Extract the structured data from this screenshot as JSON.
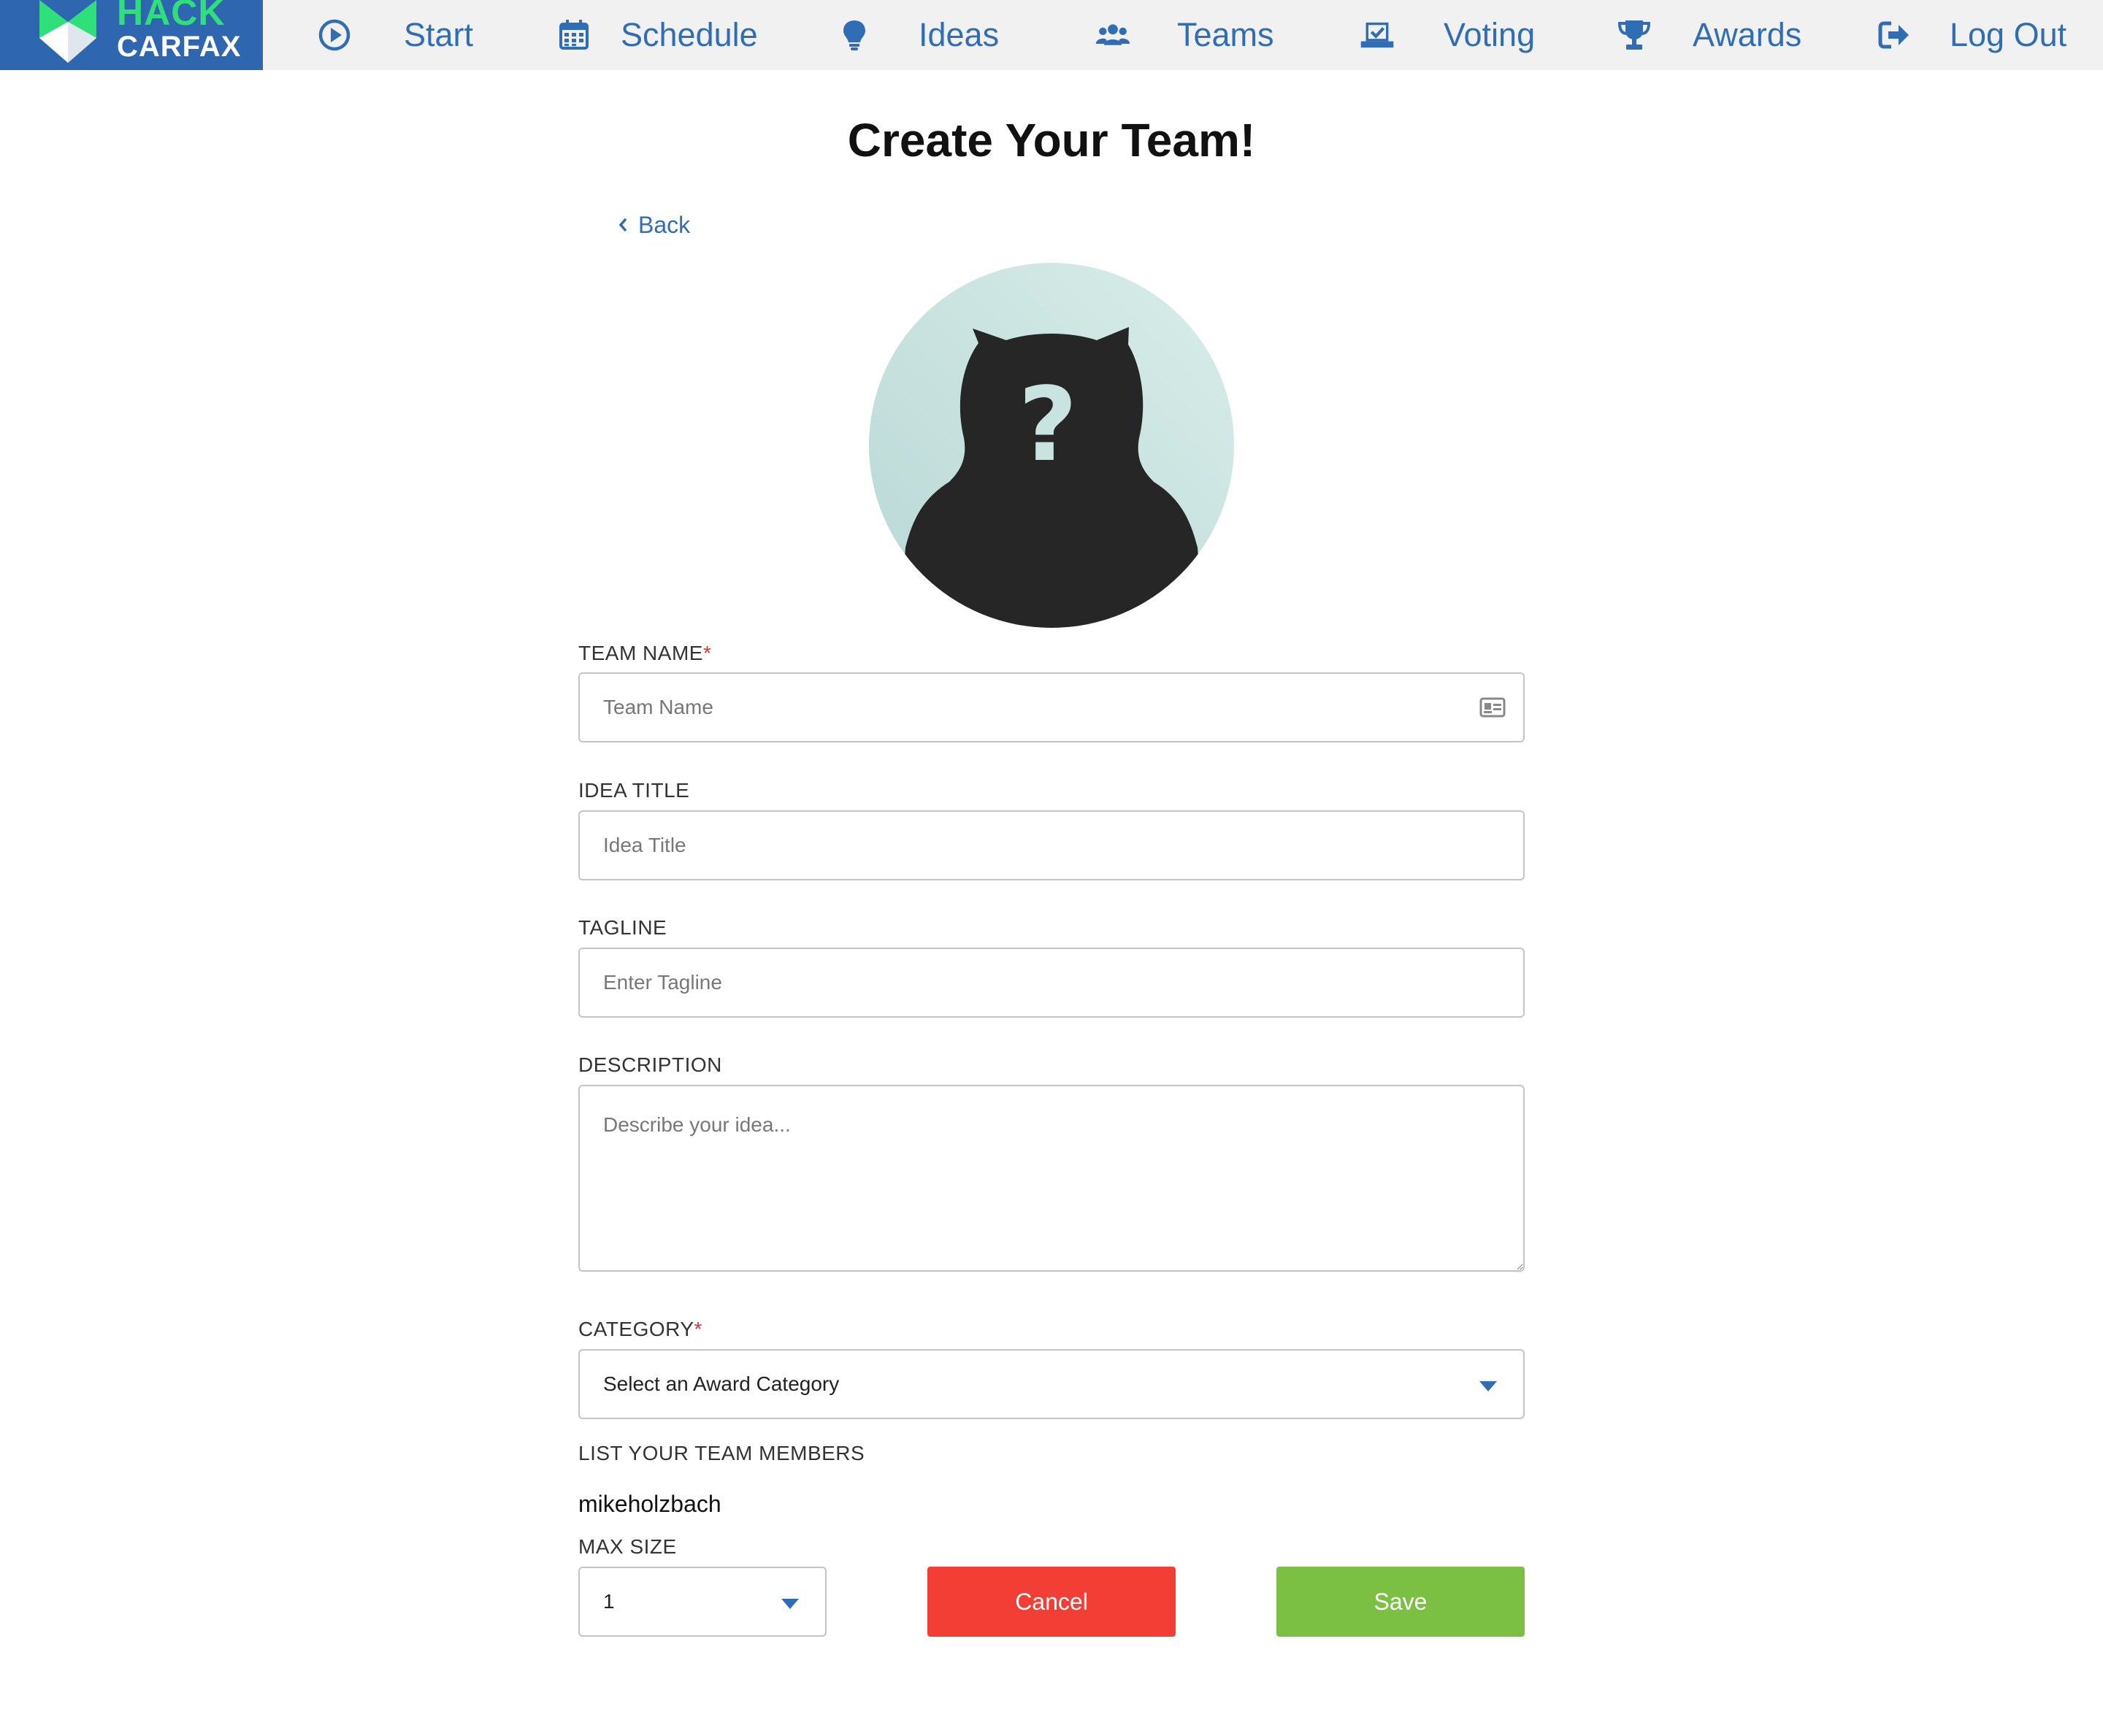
{
  "brand": {
    "line1": "HACK",
    "line2": "CARFAX"
  },
  "nav": [
    {
      "label": "Start",
      "icon": "play-circle-icon"
    },
    {
      "label": "Schedule",
      "icon": "calendar-icon"
    },
    {
      "label": "Ideas",
      "icon": "lightbulb-icon"
    },
    {
      "label": "Teams",
      "icon": "users-icon"
    },
    {
      "label": "Voting",
      "icon": "vote-box-icon"
    },
    {
      "label": "Awards",
      "icon": "trophy-icon"
    },
    {
      "label": "Log Out",
      "icon": "sign-out-icon"
    }
  ],
  "page": {
    "title": "Create Your Team!",
    "back_label": "Back",
    "avatar_glyph": "?"
  },
  "form": {
    "team_name": {
      "label": "TEAM NAME",
      "required_mark": "*",
      "placeholder": "Team Name",
      "value": ""
    },
    "idea_title": {
      "label": "IDEA TITLE",
      "placeholder": "Idea Title",
      "value": ""
    },
    "tagline": {
      "label": "TAGLINE",
      "placeholder": "Enter Tagline",
      "value": ""
    },
    "description": {
      "label": "DESCRIPTION",
      "placeholder": "Describe your idea...",
      "value": ""
    },
    "category": {
      "label": "CATEGORY",
      "required_mark": "*",
      "selected": "Select an Award Category"
    },
    "members": {
      "label": "LIST YOUR TEAM MEMBERS",
      "names": [
        "mikeholzbach"
      ]
    },
    "max_size": {
      "label": "MAX SIZE",
      "selected": "1"
    }
  },
  "buttons": {
    "cancel": "Cancel",
    "save": "Save"
  },
  "colors": {
    "brand_blue": "#2f66b0",
    "brand_green": "#2fe07a",
    "link_blue": "#2f6db5",
    "cancel_red": "#f33e36",
    "save_green": "#7bc043",
    "required_red": "#dd3333"
  }
}
